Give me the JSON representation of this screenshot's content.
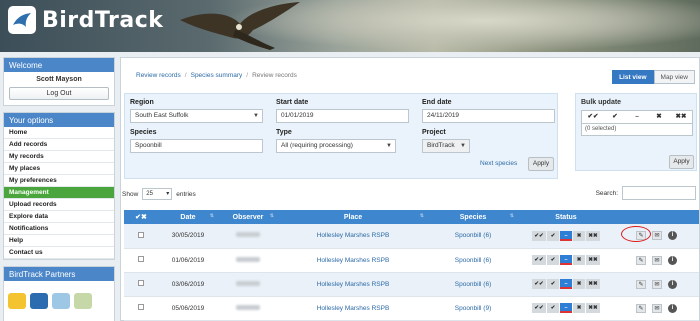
{
  "brand": {
    "title": "BirdTrack"
  },
  "sidebar": {
    "welcome": {
      "heading": "Welcome",
      "user": "Scott Mayson",
      "logout": "Log Out"
    },
    "options": {
      "heading": "Your options",
      "items": [
        "Home",
        "Add records",
        "My records",
        "My places",
        "My preferences",
        "Management",
        "Upload records",
        "Explore data",
        "Notifications",
        "Help",
        "Contact us"
      ],
      "active_index": 5
    },
    "partners": {
      "heading": "BirdTrack Partners"
    }
  },
  "breadcrumb": [
    "Review records",
    "Species summary",
    "Review records"
  ],
  "views": {
    "list": "List view",
    "map": "Map view"
  },
  "filters": {
    "region_label": "Region",
    "region_value": "South East Suffolk",
    "start_label": "Start date",
    "start_value": "01/01/2019",
    "end_label": "End date",
    "end_value": "24/11/2019",
    "species_label": "Species",
    "species_value": "Spoonbill",
    "type_label": "Type",
    "type_value": "All (requiring processing)",
    "project_label": "Project",
    "project_value": "BirdTrack",
    "next_species": "Next species",
    "apply": "Apply"
  },
  "bulk": {
    "title": "Bulk update",
    "icons": [
      "✔✔",
      "✔",
      "–",
      "✖",
      "✖✖"
    ],
    "selected": "(0 selected)",
    "apply": "Apply"
  },
  "list_controls": {
    "show": "Show",
    "length": "25",
    "entries": "entries",
    "search": "Search:"
  },
  "table": {
    "headers": {
      "check": "✔✖",
      "date": "Date",
      "observer": "Observer",
      "place": "Place",
      "species": "Species",
      "status": "Status"
    },
    "rows": [
      {
        "date": "30/05/2019",
        "place": "Hollesley Marshes RSPB",
        "species": "Spoonbill (6)"
      },
      {
        "date": "01/06/2019",
        "place": "Hollesley Marshes RSPB",
        "species": "Spoonbill (6)"
      },
      {
        "date": "03/06/2019",
        "place": "Hollesley Marshes RSPB",
        "species": "Spoonbill (6)"
      },
      {
        "date": "05/06/2019",
        "place": "Hollesley Marshes RSPB",
        "species": "Spoonbill (9)"
      }
    ],
    "status_icons": [
      "✔✔",
      "✔",
      "–",
      "✖",
      "✖✖"
    ],
    "current_status_index": 2
  },
  "colors": {
    "accent": "#3e87cf",
    "active_menu": "#4aa63c",
    "highlight": "#e01b1b"
  }
}
